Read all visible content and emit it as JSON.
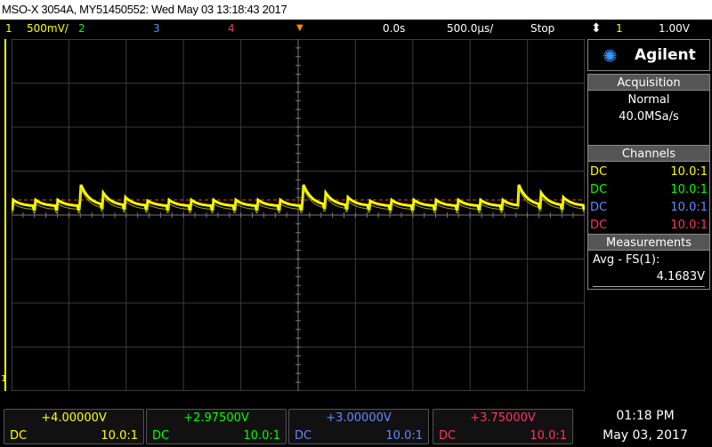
{
  "title": "MSO-X 3054A, MY51450552: Wed May 03 13:18:43 2017",
  "status": {
    "ch1_num": "1",
    "ch1_scale": "500mV/",
    "ch2_num": "2",
    "ch3_num": "3",
    "ch4_num": "4",
    "time_delay": "0.0s",
    "time_scale": "500.0µs/",
    "run_state": "Stop",
    "trigger_ch": "1",
    "trigger_level": "1.00V"
  },
  "panel": {
    "brand": "Agilent",
    "acquisition_label": "Acquisition",
    "acq_mode": "Normal",
    "sample_rate": "40.0MSa/s",
    "channels_label": "Channels",
    "channels": [
      {
        "coupling": "DC",
        "probe": "10.0:1",
        "color": "#ffff00"
      },
      {
        "coupling": "DC",
        "probe": "10.0:1",
        "color": "#00ff00"
      },
      {
        "coupling": "DC",
        "probe": "10.0:1",
        "color": "#6688ff"
      },
      {
        "coupling": "DC",
        "probe": "10.0:1",
        "color": "#ff3366"
      }
    ],
    "measurements_label": "Measurements",
    "meas_name": "Avg - FS(1):",
    "meas_value": "4.1683V"
  },
  "bottom": {
    "channels": [
      {
        "offset": "+4.00000V",
        "coupling": "DC",
        "probe": "10.0:1",
        "color": "#ffff00"
      },
      {
        "offset": "+2.97500V",
        "coupling": "DC",
        "probe": "10.0:1",
        "color": "#00ff00"
      },
      {
        "offset": "+3.00000V",
        "coupling": "DC",
        "probe": "10.0:1",
        "color": "#6688ff"
      },
      {
        "offset": "+3.75000V",
        "coupling": "DC",
        "probe": "10.0:1",
        "color": "#ff3366"
      }
    ],
    "time": "01:18 PM",
    "date": "May 03, 2017"
  },
  "grid": {
    "ground_marker": "1"
  },
  "colors": {
    "ch1": "#ffff00",
    "ch2": "#00ff00",
    "ch3": "#6688ff",
    "ch4": "#ff3366",
    "trigger_level_line": "#ff4400",
    "grid": "#3a3a3a",
    "panel_head": "#555555"
  }
}
